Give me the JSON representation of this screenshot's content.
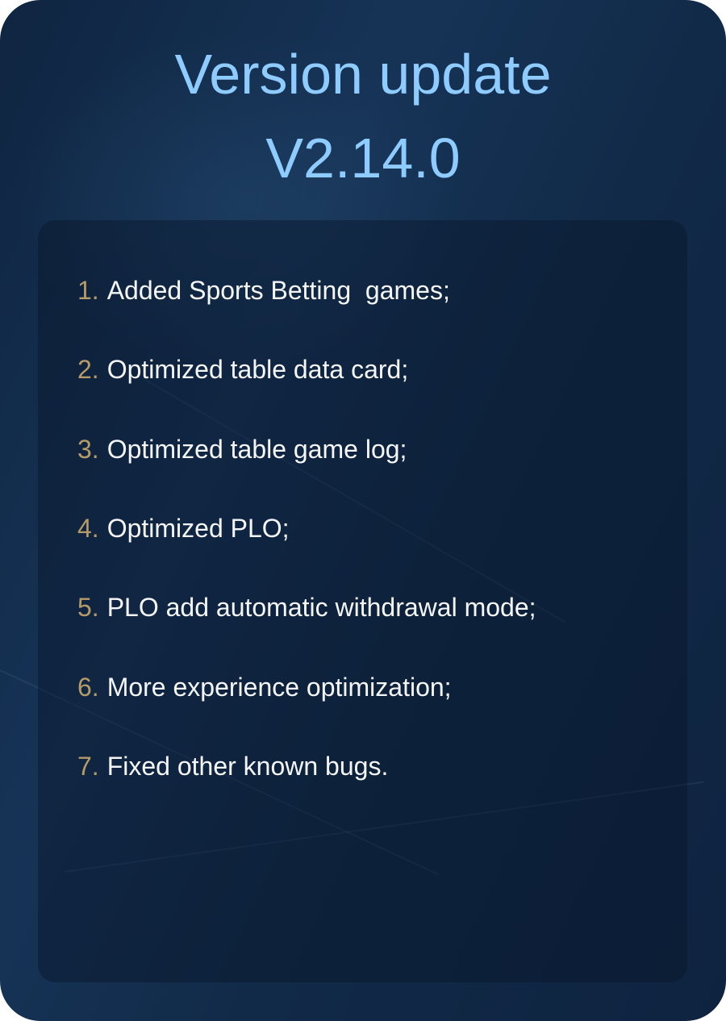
{
  "title": "Version update",
  "version": "V2.14.0",
  "items": [
    {
      "num": "1.",
      "text": "Added Sports Betting  games;"
    },
    {
      "num": "2.",
      "text": "Optimized table data card;"
    },
    {
      "num": "3.",
      "text": "Optimized table game log;"
    },
    {
      "num": "4.",
      "text": "Optimized PLO;"
    },
    {
      "num": "5.",
      "text": "PLO add automatic withdrawal mode;"
    },
    {
      "num": "6.",
      "text": "More experience optimization;"
    },
    {
      "num": "7.",
      "text": "Fixed other known bugs."
    }
  ],
  "colors": {
    "title": "#8ecbff",
    "number": "#b59b68",
    "text": "#f4f6f8",
    "background": "#112a48"
  }
}
